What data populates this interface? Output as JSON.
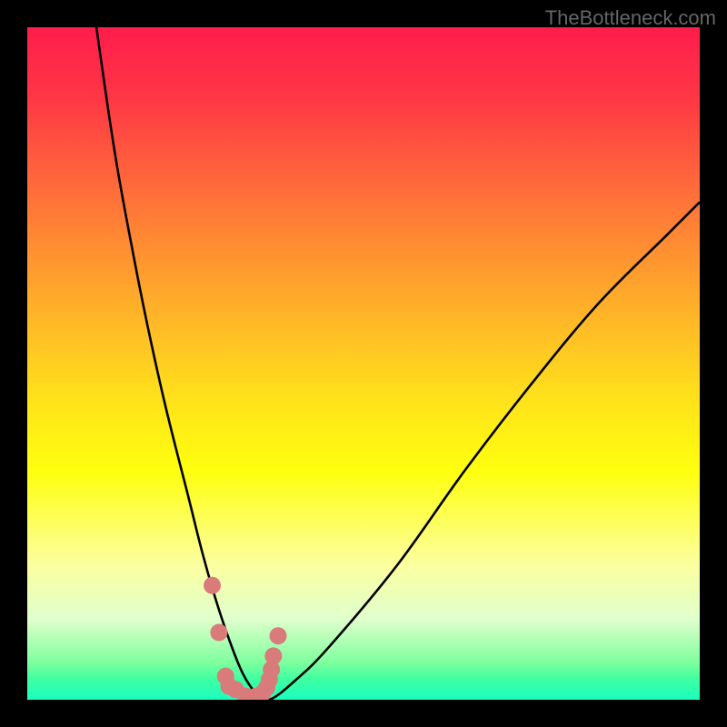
{
  "watermark": "TheBottleneck.com",
  "colors": {
    "frame": "#000000",
    "gradient_stops": [
      {
        "offset": 0.0,
        "color": "#ff1d4b"
      },
      {
        "offset": 0.1,
        "color": "#ff3545"
      },
      {
        "offset": 0.24,
        "color": "#ff6c3a"
      },
      {
        "offset": 0.4,
        "color": "#ffaa2b"
      },
      {
        "offset": 0.55,
        "color": "#ffe11b"
      },
      {
        "offset": 0.66,
        "color": "#ffff0e"
      },
      {
        "offset": 0.8,
        "color": "#fbffa0"
      },
      {
        "offset": 0.88,
        "color": "#e0ffcc"
      },
      {
        "offset": 0.945,
        "color": "#7dff9e"
      },
      {
        "offset": 0.97,
        "color": "#3dffa0"
      },
      {
        "offset": 1.0,
        "color": "#1bffc0"
      }
    ],
    "curve": "#000000",
    "marker_fill": "#d97b7b",
    "marker_stroke": "#c06a6a"
  },
  "chart_data": {
    "type": "line",
    "title": "",
    "xlabel": "",
    "ylabel": "",
    "xlim": [
      0,
      100
    ],
    "ylim": [
      0,
      100
    ],
    "note": "Axes are unlabeled; values are approximate readings of the black V-shaped curve (bottleneck percentage) where x is some hardware parameter and y is bottleneck % (0 at bottom, 100 at top).",
    "series": [
      {
        "name": "bottleneck-curve",
        "x": [
          0,
          4,
          8,
          12,
          16,
          20,
          24,
          26,
          28,
          30,
          32,
          34,
          36,
          40,
          45,
          55,
          65,
          75,
          85,
          95,
          100
        ],
        "y": [
          270,
          170,
          120,
          88,
          65,
          46,
          30,
          22,
          15,
          9,
          4,
          1,
          0,
          3,
          8,
          20,
          34,
          47,
          59,
          69,
          74
        ]
      }
    ],
    "markers": {
      "name": "highlight-points",
      "x": [
        27.5,
        28.5,
        29.5,
        30,
        31,
        32.5,
        34,
        35,
        35.6,
        36,
        36.3,
        36.6,
        37.3
      ],
      "y": [
        17,
        10,
        3.5,
        2,
        1.5,
        0.5,
        0.5,
        1,
        1.8,
        3,
        4.5,
        6.5,
        9.5
      ]
    }
  }
}
